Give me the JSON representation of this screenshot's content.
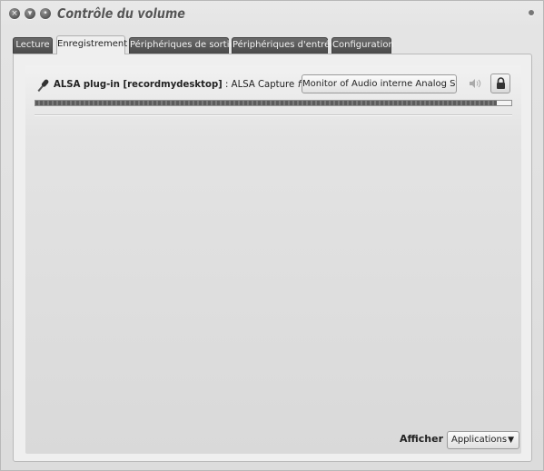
{
  "window": {
    "title": "Contrôle du volume",
    "buttons": {
      "close": "×",
      "minimize": "▾",
      "maximize": "•"
    }
  },
  "tabs": [
    {
      "label": "Lecture",
      "active": false
    },
    {
      "label": "Enregistrement",
      "active": true
    },
    {
      "label": "Périphériques de sortie",
      "active": false
    },
    {
      "label": "Périphériques d'entrée",
      "active": false
    },
    {
      "label": "Configuration",
      "active": false
    }
  ],
  "stream": {
    "icon": "microphone-icon",
    "app_name": "ALSA plug-in [recordmydesktop]",
    "separator": " : ",
    "stream_name": "ALSA Capture",
    "from_label": "from",
    "device": "Monitor of Audio interne Analog Stereo",
    "level_fraction": 0.97
  },
  "footer": {
    "show_label": "Afficher",
    "show_colon": " :",
    "show_value": "Applications",
    "dropdown_arrow": "▼"
  }
}
